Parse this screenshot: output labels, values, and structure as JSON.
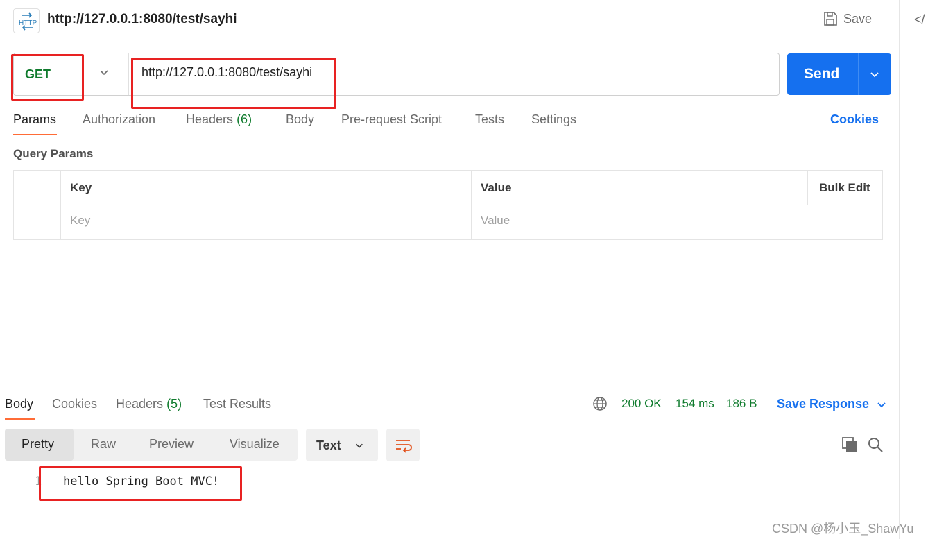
{
  "colors": {
    "accent": "#1570ef",
    "method": "#0f7b2d",
    "tab_indicator": "#ff6c37",
    "status": "#0f7b2d",
    "annotation_box": "#e82222"
  },
  "header": {
    "http_icon_label": "HTTP",
    "title": "http://127.0.0.1:8080/test/sayhi",
    "save_label": "Save",
    "code_icon_glyph": "</"
  },
  "request": {
    "method": "GET",
    "url": "http://127.0.0.1:8080/test/sayhi",
    "send_label": "Send",
    "tabs": [
      {
        "label": "Params"
      },
      {
        "label": "Authorization"
      },
      {
        "label": "Headers",
        "count": "(6)"
      },
      {
        "label": "Body"
      },
      {
        "label": "Pre-request Script"
      },
      {
        "label": "Tests"
      },
      {
        "label": "Settings"
      }
    ],
    "cookies_label": "Cookies",
    "query_params_title": "Query Params",
    "table": {
      "headers": [
        "Key",
        "Value",
        "Bulk Edit"
      ],
      "key_placeholder": "Key",
      "value_placeholder": "Value"
    }
  },
  "response": {
    "tabs": [
      {
        "label": "Body"
      },
      {
        "label": "Cookies"
      },
      {
        "label": "Headers",
        "count": "(5)"
      },
      {
        "label": "Test Results"
      }
    ],
    "status": "200 OK",
    "time": "154 ms",
    "size": "186 B",
    "save_response_label": "Save Response",
    "views": [
      "Pretty",
      "Raw",
      "Preview",
      "Visualize"
    ],
    "format": "Text",
    "lines": [
      {
        "no": "1",
        "text": "hello Spring Boot MVC!"
      }
    ]
  },
  "watermark": "CSDN @杨小玉_ShawYu"
}
